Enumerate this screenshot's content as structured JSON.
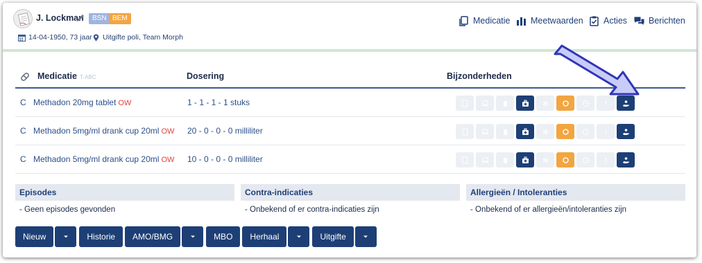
{
  "patient": {
    "name": "J. Lockman",
    "badges": [
      "BSN",
      "BEM"
    ],
    "dob": "14-04-1950, 73 jaar",
    "location": "Uitgifte poli, Team Morph"
  },
  "topnav": [
    {
      "label": "Medicatie",
      "icon": "copy-icon"
    },
    {
      "label": "Meetwaarden",
      "icon": "bar-chart-icon"
    },
    {
      "label": "Acties",
      "icon": "clipboard-check-icon"
    },
    {
      "label": "Berichten",
      "icon": "chat-icon"
    }
  ],
  "table": {
    "headers": {
      "medication": "Medicatie",
      "medication_sub": "T-ABC",
      "dosage": "Dosering",
      "details": "Bijzonderheden"
    },
    "rows": [
      {
        "code": "C",
        "name": "Methadon 20mg tablet",
        "flag": "OW",
        "dose": "1 - 1 - 1 - 1 stuks"
      },
      {
        "code": "C",
        "name": "Methadon 5mg/ml drank cup 20ml",
        "flag": "OW",
        "dose": "20 - 0 - 0 - 0 milliliter"
      },
      {
        "code": "C",
        "name": "Methadon 5mg/ml drank cup 20ml",
        "flag": "OW",
        "dose": "10 - 0 - 0 - 0 milliliter"
      }
    ]
  },
  "panels": {
    "episodes": {
      "title": "Episodes",
      "text": "- Geen episodes gevonden"
    },
    "contra": {
      "title": "Contra-indicaties",
      "text": "- Onbekend of er contra-indicaties zijn"
    },
    "allergies": {
      "title": "Allergieën / Intoleranties",
      "text": "- Onbekend of er allergieën/intoleranties zijn"
    }
  },
  "buttons": {
    "nieuw": "Nieuw",
    "historie": "Historie",
    "amo": "AMO/BMG",
    "mbo": "MBO",
    "herhaal": "Herhaal",
    "uitgifte": "Uitgifte"
  },
  "colors": {
    "navy": "#1d3f76",
    "orange": "#f2a541",
    "badge_bsn": "#9fb5e0",
    "divider_green": "#cfe7d6",
    "flag_red": "#e0413a",
    "annotation_arrow": "#c9ccf6"
  }
}
